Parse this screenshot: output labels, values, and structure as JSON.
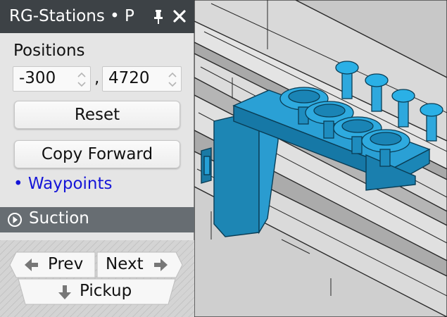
{
  "panel": {
    "title": "RG-Stations • P",
    "pin_icon": "pin-icon",
    "close_icon": "close-icon",
    "positions_label": "Positions",
    "position_x": "-300",
    "position_separator": ",",
    "position_y": "4720",
    "reset_label": "Reset",
    "copy_forward_label": "Copy Forward",
    "waypoints_label": "• Waypoints",
    "suction_label": "Suction",
    "prev_label": "Prev",
    "next_label": "Next",
    "pickup_label": "Pickup"
  },
  "colors": {
    "title_bar": "#3d4246",
    "suction_bar": "#676d72",
    "link": "#1515d8",
    "gripper_blue": "#1f8fbf",
    "rail_grey": "#d2d2d2"
  },
  "viewport": {
    "content": "3D view of gripper with suction cups over rails"
  }
}
